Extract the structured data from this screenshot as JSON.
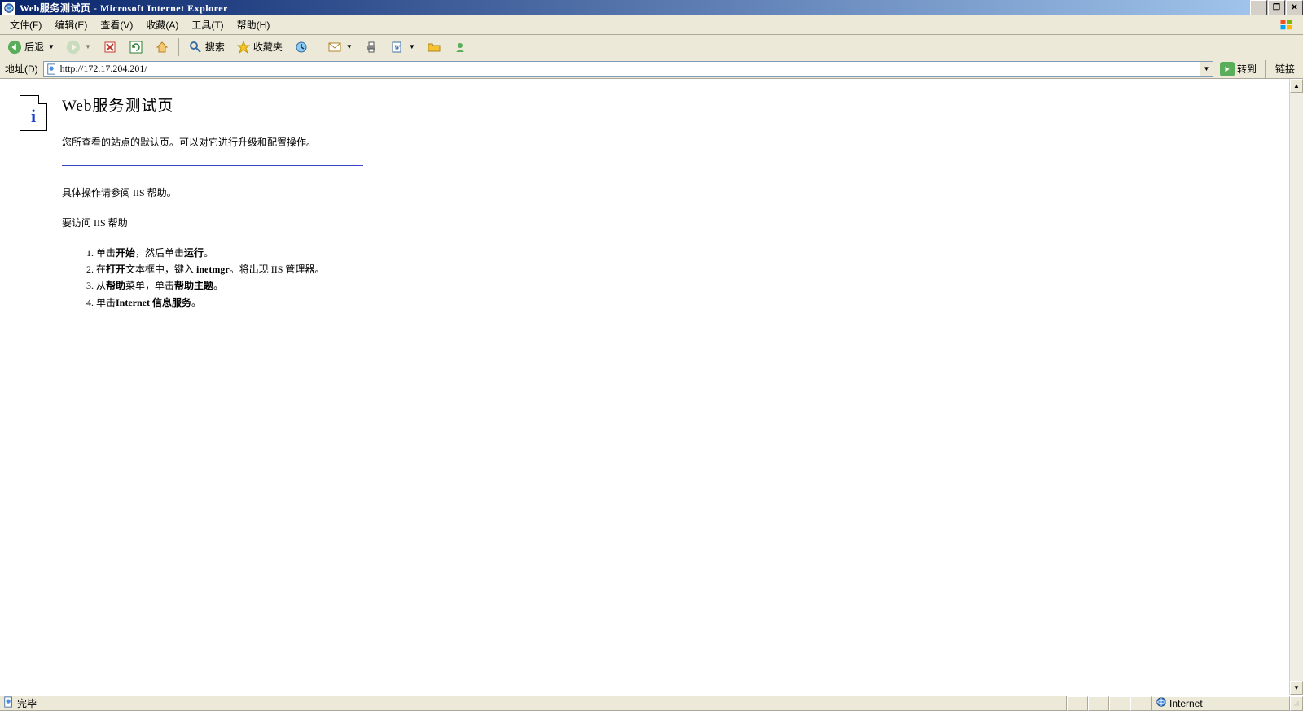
{
  "window": {
    "title": "Web服务测试页 - Microsoft Internet Explorer",
    "minimize": "_",
    "maximize": "❐",
    "close": "✕"
  },
  "menu": {
    "file": "文件(F)",
    "edit": "编辑(E)",
    "view": "查看(V)",
    "favorites": "收藏(A)",
    "tools": "工具(T)",
    "help": "帮助(H)"
  },
  "toolbar": {
    "back": "后退",
    "search": "搜索",
    "favorites": "收藏夹"
  },
  "address": {
    "label": "地址(D)",
    "url": "http://172.17.204.201/",
    "go": "转到",
    "links": "链接"
  },
  "page": {
    "h1": "Web服务测试页",
    "p1": "您所查看的站点的默认页。可以对它进行升级和配置操作。",
    "p2": "具体操作请参阅 IIS 帮助。",
    "p3": "要访问 IIS 帮助",
    "li1_a": "单击",
    "li1_b": "开始",
    "li1_c": "，然后单击",
    "li1_d": "运行",
    "li1_e": "。",
    "li2_a": "在",
    "li2_b": "打开",
    "li2_c": "文本框中，键入 ",
    "li2_d": "inetmgr",
    "li2_e": "。将出现 IIS 管理器。",
    "li3_a": "从",
    "li3_b": "帮助",
    "li3_c": "菜单，单击",
    "li3_d": "帮助主题",
    "li3_e": "。",
    "li4_a": "单击",
    "li4_b": "Internet 信息服务",
    "li4_c": "。"
  },
  "status": {
    "done": "完毕",
    "zone": "Internet"
  }
}
